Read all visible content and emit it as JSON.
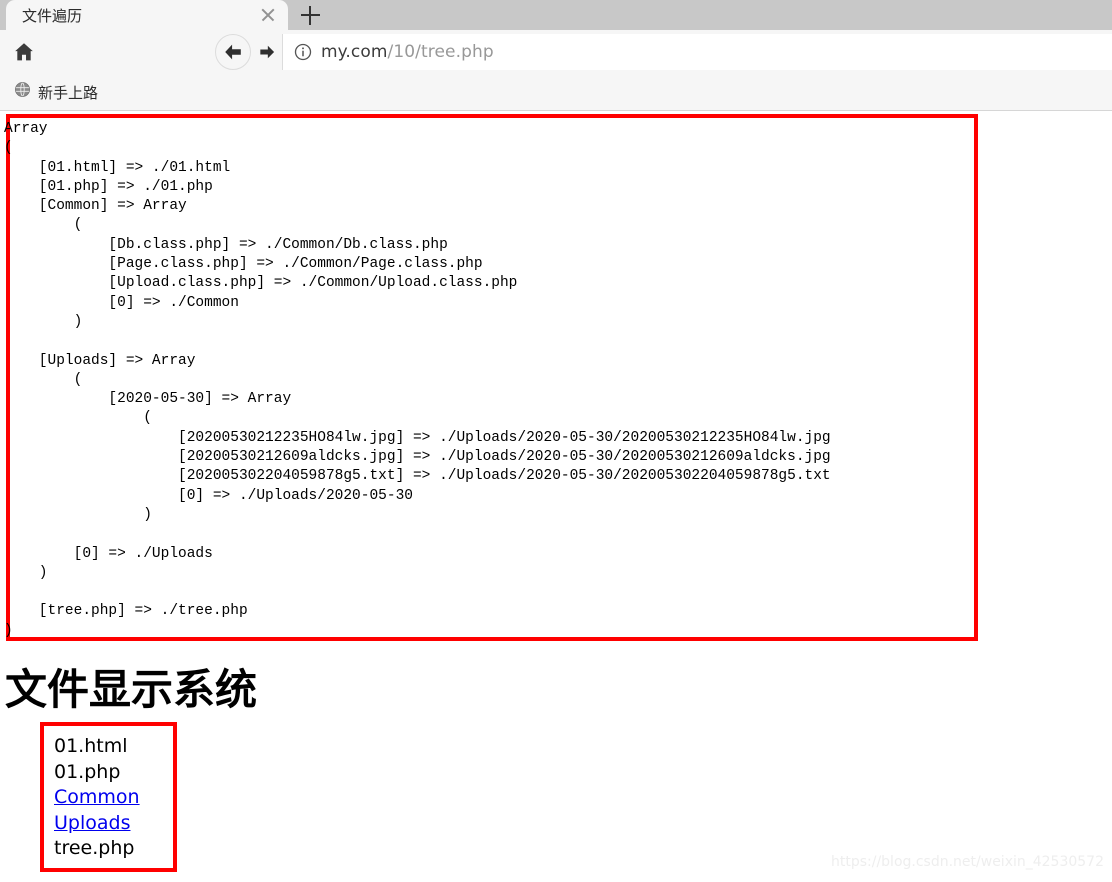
{
  "browser": {
    "tab": {
      "title": "文件遍历",
      "close_icon": "close-icon",
      "newtab_icon": "plus-icon"
    },
    "toolbar": {
      "home_icon": "home-icon",
      "back_icon": "back-arrow-icon",
      "forward_icon": "forward-arrow-icon",
      "info_icon": "info-circle-icon",
      "url_host": "my.com",
      "url_path": "/10/tree.php"
    },
    "bookmarks": [
      {
        "label": "新手上路",
        "icon": "globe-icon"
      }
    ]
  },
  "page": {
    "tree_dump": "Array\n(\n    [01.html] => ./01.html\n    [01.php] => ./01.php\n    [Common] => Array\n        (\n            [Db.class.php] => ./Common/Db.class.php\n            [Page.class.php] => ./Common/Page.class.php\n            [Upload.class.php] => ./Common/Upload.class.php\n            [0] => ./Common\n        )\n\n    [Uploads] => Array\n        (\n            [2020-05-30] => Array\n                (\n                    [20200530212235HO84lw.jpg] => ./Uploads/2020-05-30/20200530212235HO84lw.jpg\n                    [20200530212609aldcks.jpg] => ./Uploads/2020-05-30/20200530212609aldcks.jpg\n                    [202005302204059878g5.txt] => ./Uploads/2020-05-30/202005302204059878g5.txt\n                    [0] => ./Uploads/2020-05-30\n                )\n\n        [0] => ./Uploads\n    )\n\n    [tree.php] => ./tree.php\n)",
    "heading": "文件显示系统",
    "file_list": [
      {
        "label": "01.html",
        "is_link": false
      },
      {
        "label": "01.php",
        "is_link": false
      },
      {
        "label": "Common",
        "is_link": true
      },
      {
        "label": "Uploads",
        "is_link": true
      },
      {
        "label": "tree.php",
        "is_link": false
      }
    ],
    "watermark": "https://blog.csdn.net/weixin_42530572"
  },
  "colors": {
    "highlight_border": "#ff0000",
    "link": "#0000ee",
    "chrome_tabstrip": "#c8c8c8",
    "chrome_toolbar": "#f6f6f6"
  }
}
